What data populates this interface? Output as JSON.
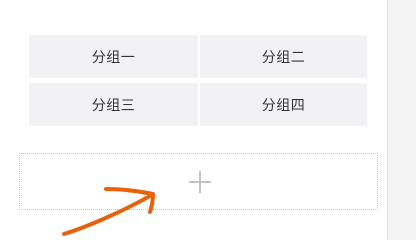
{
  "groups": [
    {
      "label": "分组一"
    },
    {
      "label": "分组二"
    },
    {
      "label": "分组三"
    },
    {
      "label": "分组四"
    }
  ],
  "add_group": {
    "icon": "plus-icon"
  },
  "annotation": {
    "icon": "arrow-icon",
    "color": "#e8620e"
  }
}
